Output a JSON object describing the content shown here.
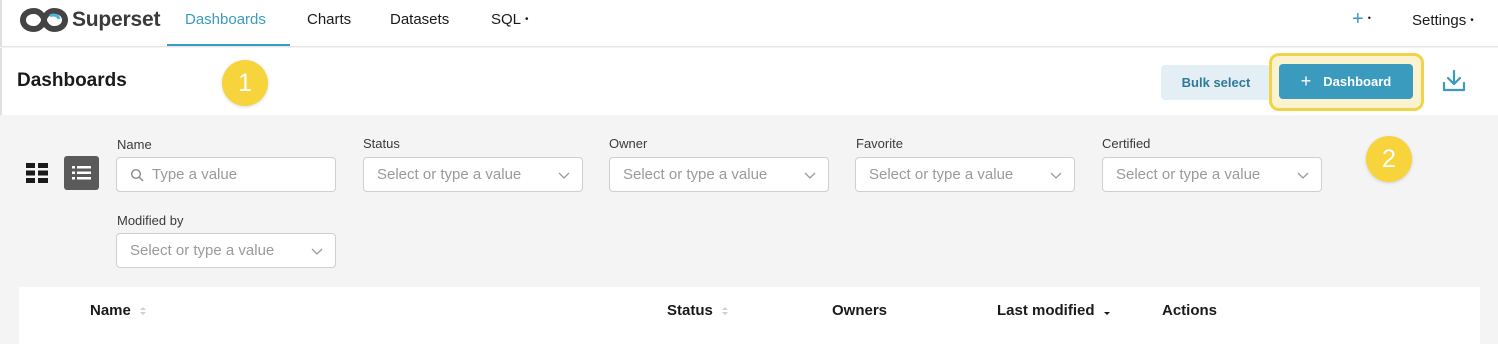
{
  "nav": {
    "brand": "Superset",
    "items": [
      {
        "label": "Dashboards",
        "active": true
      },
      {
        "label": "Charts"
      },
      {
        "label": "Datasets"
      },
      {
        "label": "SQL"
      }
    ],
    "plus_label": "+",
    "settings_label": "Settings"
  },
  "header": {
    "title": "Dashboards",
    "bulk_select_label": "Bulk select",
    "add_dashboard_label": "Dashboard",
    "add_dashboard_plus": "+"
  },
  "badges": [
    "1",
    "2"
  ],
  "filters": [
    {
      "label": "Name",
      "placeholder": "Type a value",
      "type": "search"
    },
    {
      "label": "Status",
      "placeholder": "Select or type a value",
      "type": "select"
    },
    {
      "label": "Owner",
      "placeholder": "Select or type a value",
      "type": "select"
    },
    {
      "label": "Favorite",
      "placeholder": "Select or type a value",
      "type": "select"
    },
    {
      "label": "Certified",
      "placeholder": "Select or type a value",
      "type": "select"
    },
    {
      "label": "Modified by",
      "placeholder": "Select or type a value",
      "type": "select"
    }
  ],
  "table": {
    "columns": [
      "Name",
      "Status",
      "Owners",
      "Last modified",
      "Actions"
    ]
  },
  "colors": {
    "accent": "#3a9bbf",
    "badge": "#f7d33c",
    "highlight": "#f2d24a"
  },
  "icons": [
    "superset-logo-icon",
    "grid-view-icon",
    "list-view-icon",
    "download-icon",
    "search-icon",
    "chevron-down-icon",
    "sort-icon",
    "sort-desc-icon"
  ]
}
